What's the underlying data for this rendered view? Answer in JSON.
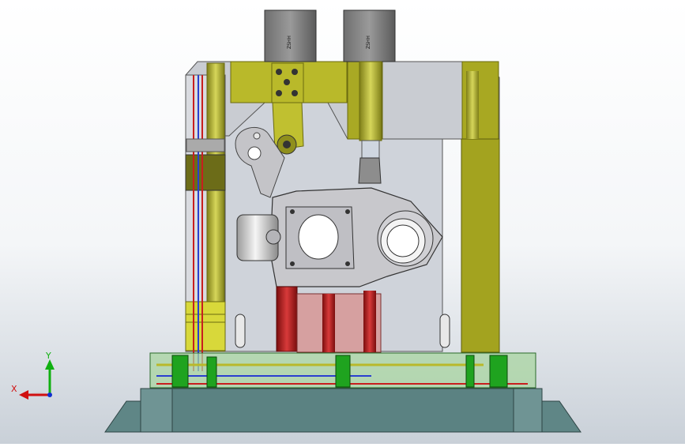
{
  "viewport": {
    "description_free": true
  },
  "triad": {
    "x_label": "X",
    "y_label": "Y",
    "colors": {
      "x": "#d01010",
      "y": "#10b010",
      "z": "#1030d0"
    }
  },
  "cylinders": [
    {
      "marking": "ZSHH"
    },
    {
      "marking": "ZSHH"
    }
  ],
  "colors": {
    "frame_yellow": "#b9b92a",
    "frame_yellow_dark": "#8e8e16",
    "base_gray": "#5f8686",
    "base_plate": "#97ad97",
    "glass_green": "#a8d4a0",
    "part_gray": "#c8c8cc",
    "pipe_red": "#c81e1e",
    "pipe_blue": "#2a3fd0",
    "fitting_green": "#1fa31f"
  }
}
